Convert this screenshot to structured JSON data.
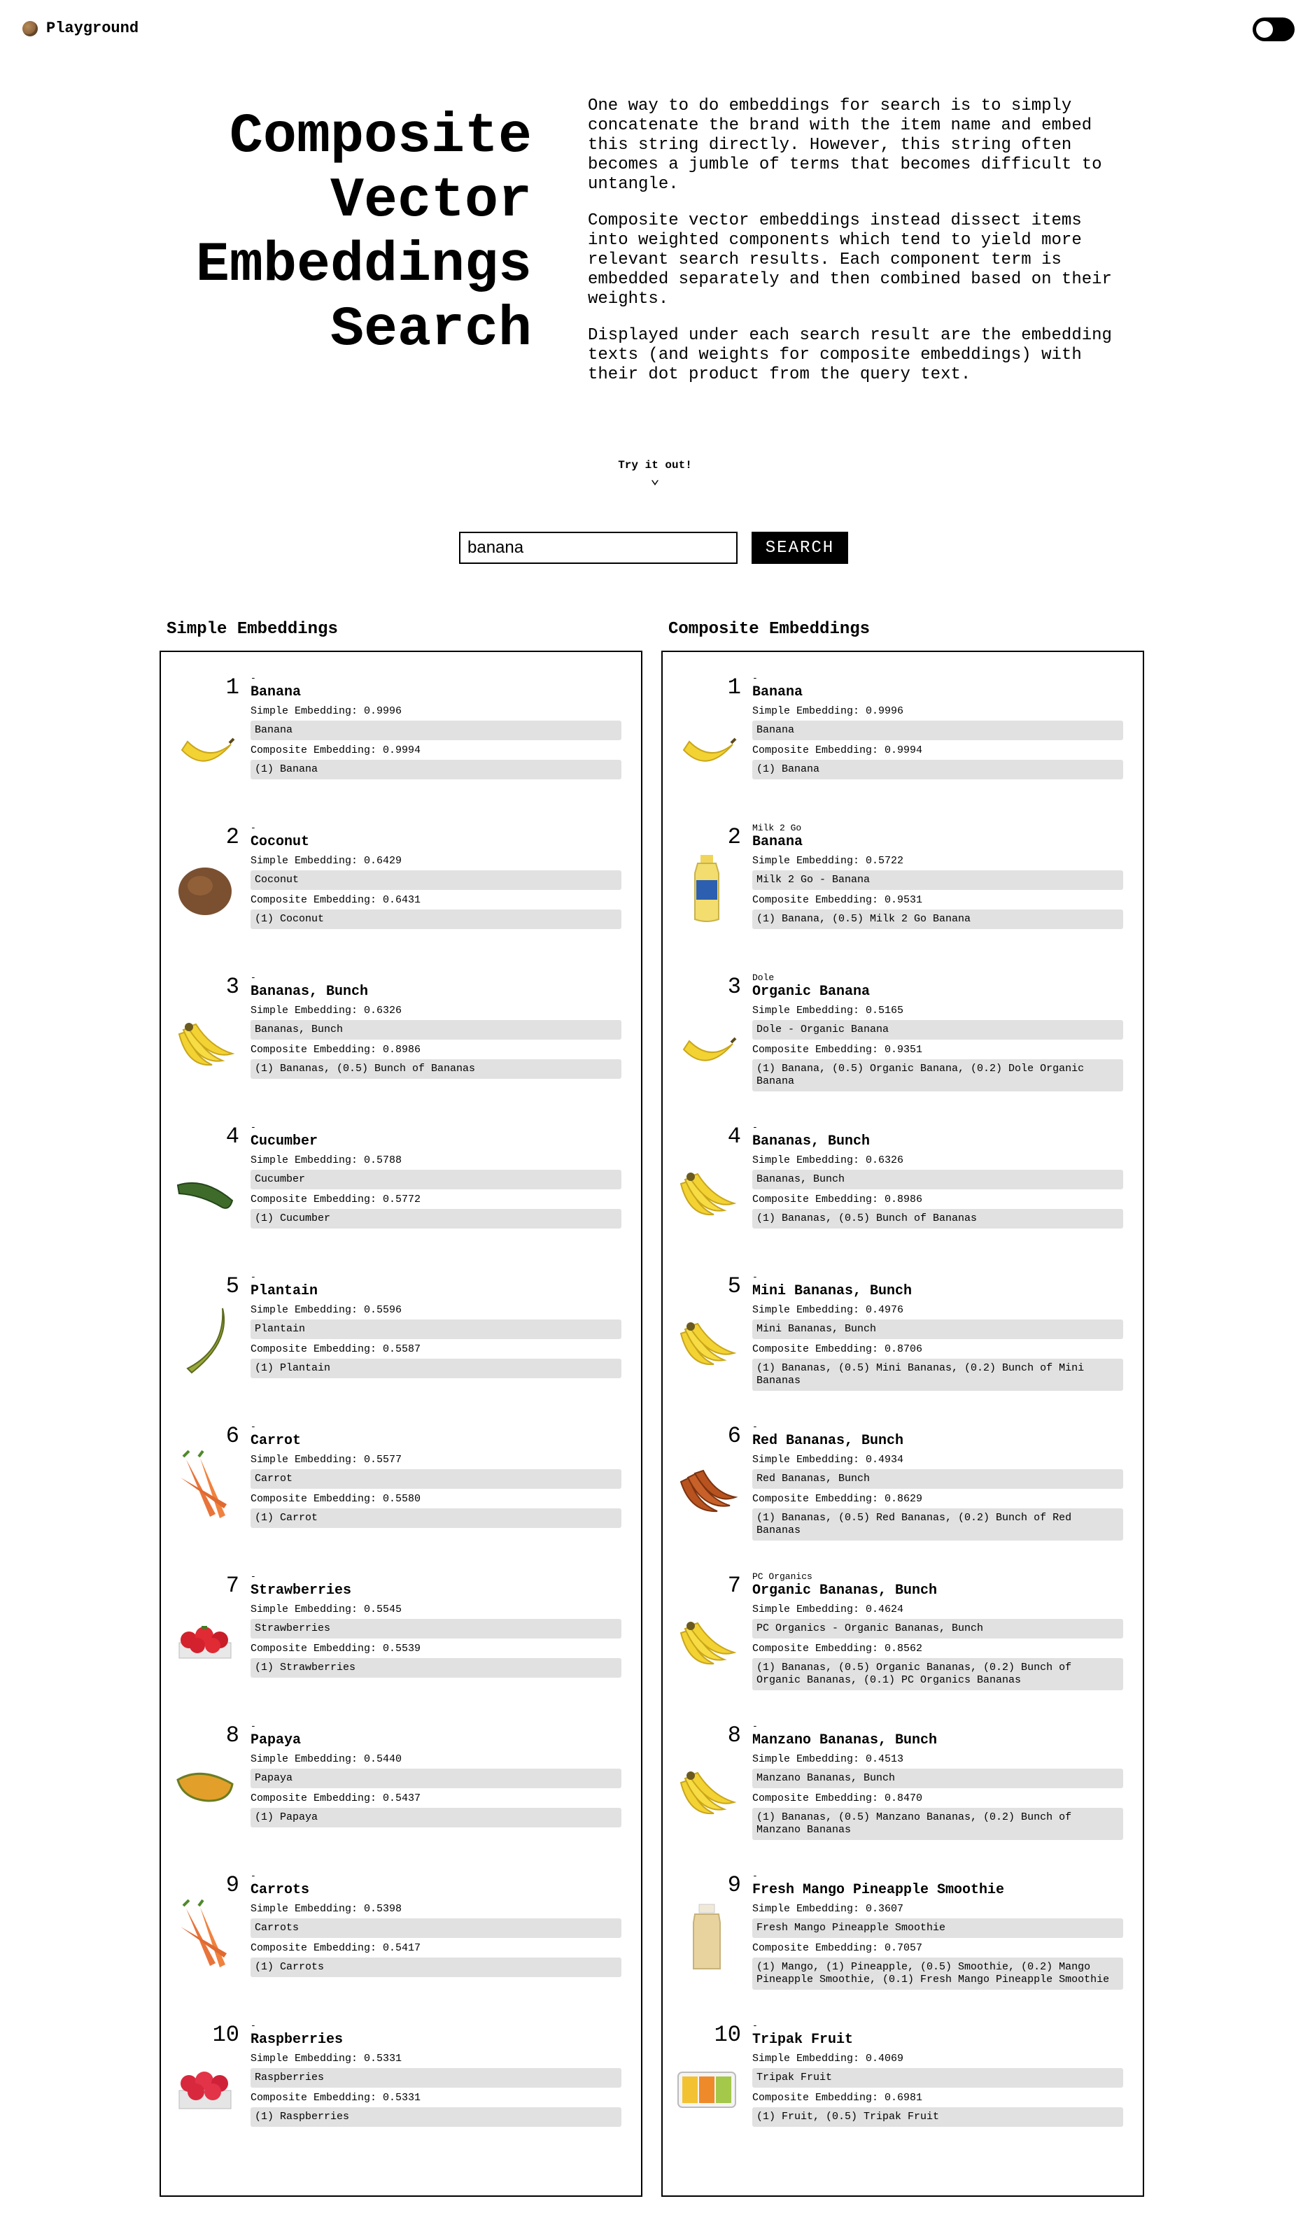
{
  "app": {
    "brand": "Playground"
  },
  "hero": {
    "title_lines": [
      "Composite",
      "Vector",
      "Embeddings",
      "Search"
    ],
    "paragraphs": [
      "One way to do embeddings for search is to simply concatenate the brand with the item name and embed this string directly. However, this string often becomes a jumble of terms that becomes difficult to untangle.",
      "Composite vector embeddings instead dissect items into weighted components which tend to yield more relevant search results. Each component term is embedded separately and then combined based on their weights.",
      "Displayed under each search result are the embedding texts (and weights for composite embeddings) with their dot product from the query text."
    ]
  },
  "try": {
    "label": "Try it out!",
    "chevron": "⌄"
  },
  "search": {
    "value": "banana",
    "button": "SEARCH"
  },
  "labels": {
    "simple": "Simple Embedding:",
    "composite": "Composite Embedding:"
  },
  "columns": [
    {
      "title": "Simple Embeddings",
      "results": [
        {
          "rank": "1",
          "brand": "-",
          "name": "Banana",
          "simple_score": "0.9996",
          "simple_text": "Banana",
          "composite_score": "0.9994",
          "composite_text": "(1) Banana",
          "icon": "banana"
        },
        {
          "rank": "2",
          "brand": "-",
          "name": "Coconut",
          "simple_score": "0.6429",
          "simple_text": "Coconut",
          "composite_score": "0.6431",
          "composite_text": "(1) Coconut",
          "icon": "coconut"
        },
        {
          "rank": "3",
          "brand": "-",
          "name": "Bananas, Bunch",
          "simple_score": "0.6326",
          "simple_text": "Bananas, Bunch",
          "composite_score": "0.8986",
          "composite_text": "(1) Bananas, (0.5) Bunch of Bananas",
          "icon": "banana-bunch"
        },
        {
          "rank": "4",
          "brand": "-",
          "name": "Cucumber",
          "simple_score": "0.5788",
          "simple_text": "Cucumber",
          "composite_score": "0.5772",
          "composite_text": "(1) Cucumber",
          "icon": "cucumber"
        },
        {
          "rank": "5",
          "brand": "-",
          "name": "Plantain",
          "simple_score": "0.5596",
          "simple_text": "Plantain",
          "composite_score": "0.5587",
          "composite_text": "(1) Plantain",
          "icon": "plantain"
        },
        {
          "rank": "6",
          "brand": "-",
          "name": "Carrot",
          "simple_score": "0.5577",
          "simple_text": "Carrot",
          "composite_score": "0.5580",
          "composite_text": "(1) Carrot",
          "icon": "carrot"
        },
        {
          "rank": "7",
          "brand": "-",
          "name": "Strawberries",
          "simple_score": "0.5545",
          "simple_text": "Strawberries",
          "composite_score": "0.5539",
          "composite_text": "(1) Strawberries",
          "icon": "strawberries"
        },
        {
          "rank": "8",
          "brand": "-",
          "name": "Papaya",
          "simple_score": "0.5440",
          "simple_text": "Papaya",
          "composite_score": "0.5437",
          "composite_text": "(1) Papaya",
          "icon": "papaya"
        },
        {
          "rank": "9",
          "brand": "-",
          "name": "Carrots",
          "simple_score": "0.5398",
          "simple_text": "Carrots",
          "composite_score": "0.5417",
          "composite_text": "(1) Carrots",
          "icon": "carrot"
        },
        {
          "rank": "10",
          "brand": "-",
          "name": "Raspberries",
          "simple_score": "0.5331",
          "simple_text": "Raspberries",
          "composite_score": "0.5331",
          "composite_text": "(1) Raspberries",
          "icon": "raspberries"
        }
      ]
    },
    {
      "title": "Composite Embeddings",
      "results": [
        {
          "rank": "1",
          "brand": "-",
          "name": "Banana",
          "simple_score": "0.9996",
          "simple_text": "Banana",
          "composite_score": "0.9994",
          "composite_text": "(1) Banana",
          "icon": "banana"
        },
        {
          "rank": "2",
          "brand": "Milk 2 Go",
          "name": "Banana",
          "simple_score": "0.5722",
          "simple_text": "Milk 2 Go - Banana",
          "composite_score": "0.9531",
          "composite_text": "(1) Banana, (0.5) Milk 2 Go Banana",
          "icon": "milk-bottle"
        },
        {
          "rank": "3",
          "brand": "Dole",
          "name": "Organic Banana",
          "simple_score": "0.5165",
          "simple_text": "Dole - Organic Banana",
          "composite_score": "0.9351",
          "composite_text": "(1) Banana, (0.5) Organic Banana, (0.2) Dole Organic Banana",
          "icon": "banana"
        },
        {
          "rank": "4",
          "brand": "-",
          "name": "Bananas, Bunch",
          "simple_score": "0.6326",
          "simple_text": "Bananas, Bunch",
          "composite_score": "0.8986",
          "composite_text": "(1) Bananas, (0.5) Bunch of Bananas",
          "icon": "banana-bunch"
        },
        {
          "rank": "5",
          "brand": "-",
          "name": "Mini Bananas, Bunch",
          "simple_score": "0.4976",
          "simple_text": "Mini Bananas, Bunch",
          "composite_score": "0.8706",
          "composite_text": "(1) Bananas, (0.5) Mini Bananas, (0.2) Bunch of Mini Bananas",
          "icon": "banana-bunch"
        },
        {
          "rank": "6",
          "brand": "-",
          "name": "Red Bananas, Bunch",
          "simple_score": "0.4934",
          "simple_text": "Red Bananas, Bunch",
          "composite_score": "0.8629",
          "composite_text": "(1) Bananas, (0.5) Red Bananas, (0.2) Bunch of Red Bananas",
          "icon": "red-bananas"
        },
        {
          "rank": "7",
          "brand": "PC Organics",
          "name": "Organic Bananas, Bunch",
          "simple_score": "0.4624",
          "simple_text": "PC Organics - Organic Bananas, Bunch",
          "composite_score": "0.8562",
          "composite_text": "(1) Bananas, (0.5) Organic Bananas, (0.2) Bunch of Organic Bananas, (0.1) PC Organics Bananas",
          "icon": "banana-bunch"
        },
        {
          "rank": "8",
          "brand": "-",
          "name": "Manzano Bananas, Bunch",
          "simple_score": "0.4513",
          "simple_text": "Manzano Bananas, Bunch",
          "composite_score": "0.8470",
          "composite_text": "(1) Bananas, (0.5) Manzano Bananas, (0.2) Bunch of Manzano Bananas",
          "icon": "banana-bunch"
        },
        {
          "rank": "9",
          "brand": "-",
          "name": "Fresh Mango Pineapple Smoothie",
          "simple_score": "0.3607",
          "simple_text": "Fresh Mango Pineapple Smoothie",
          "composite_score": "0.7057",
          "composite_text": "(1) Mango, (1) Pineapple, (0.5) Smoothie, (0.2) Mango Pineapple Smoothie, (0.1) Fresh Mango Pineapple Smoothie",
          "icon": "smoothie-bottle"
        },
        {
          "rank": "10",
          "brand": "-",
          "name": "Tripak Fruit",
          "simple_score": "0.4069",
          "simple_text": "Tripak Fruit",
          "composite_score": "0.6981",
          "composite_text": "(1) Fruit, (0.5) Tripak Fruit",
          "icon": "fruit-tray"
        }
      ]
    }
  ]
}
